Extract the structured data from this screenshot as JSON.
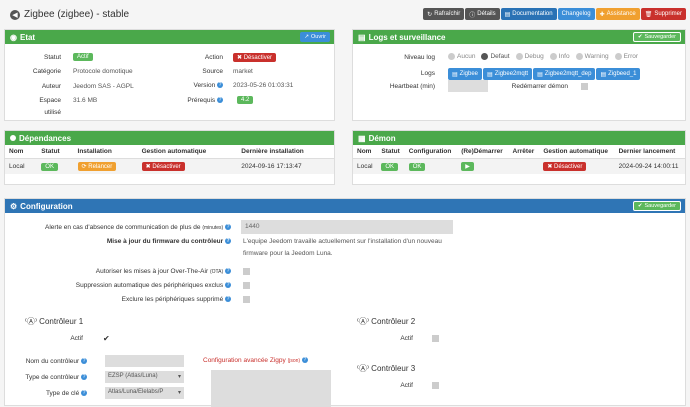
{
  "header": {
    "title": "Zigbee (zigbee) - stable",
    "buttons": {
      "refresh": "Rafraîchir",
      "details": "Détails",
      "documentation": "Documentation",
      "changelog": "Changelog",
      "assistance": "Assistance",
      "delete": "Supprimer"
    }
  },
  "etat": {
    "title": "Etat",
    "open_label": "Ouvrir",
    "statut_label": "Statut",
    "statut_value": "Actif",
    "categorie_label": "Catégorie",
    "categorie_value": "Protocole domotique",
    "auteur_label": "Auteur",
    "auteur_value": "Jeedom SAS - AGPL",
    "espace_label": "Espace",
    "espace_label2": "utilisé",
    "espace_value": "31.6 MB",
    "action_label": "Action",
    "action_value": "Désactiver",
    "source_label": "Source",
    "source_value": "market",
    "version_label": "Version",
    "version_value": "2023-05-26 01:03:31",
    "prerequis_label": "Prérequis",
    "prerequis_value": "4.2"
  },
  "logs": {
    "title": "Logs et surveillance",
    "save_label": "Sauvegarder",
    "niveau_label": "Niveau log",
    "levels": [
      "Aucun",
      "Defaut",
      "Debug",
      "Info",
      "Warning",
      "Error"
    ],
    "logs_label": "Logs",
    "log_buttons": [
      "Zigbee",
      "Zigbee2mqtt",
      "Zigbee2mqtt_dep",
      "Zigbeed_1"
    ],
    "heartbeat_label": "Heartbeat (min)",
    "restart_label": "Redémarrer démon"
  },
  "deps": {
    "title": "Dépendances",
    "headers": [
      "Nom",
      "Statut",
      "Installation",
      "Gestion automatique",
      "Dernière installation"
    ],
    "nom": "Local",
    "statut": "OK",
    "installation": "Relancer",
    "gestion": "Désactiver",
    "derniere": "2024-09-16 17:13:47"
  },
  "demon": {
    "title": "Démon",
    "headers": [
      "Nom",
      "Statut",
      "Configuration",
      "(Re)Démarrer",
      "Arrêter",
      "Gestion automatique",
      "Dernier lancement"
    ],
    "nom": "Local",
    "statut": "OK",
    "configuration": "OK",
    "gestion": "Désactiver",
    "dernier": "2024-09-24 14:00:11"
  },
  "config": {
    "title": "Configuration",
    "save_label": "Sauvegarder",
    "alerte_label": "Alerte en cas d'absence de communication de plus de",
    "alerte_unit": "(minutes)",
    "alerte_value": "1440",
    "firmware_label": "Mise à jour du firmware du contrôleur",
    "firmware_text1": "L'equipe Jeedom travaille actuellement sur l'installation d'un nouveau",
    "firmware_text2": "firmware pour la Jeedom Luna.",
    "ota_label": "Autoriser les mises à jour Over-The-Air",
    "ota_unit": "(OTA)",
    "suppr_label": "Suppression automatique des périphériques exclus",
    "exclure_label": "Exclure les périphériques supprimé",
    "ctrl1_title": "Contrôleur 1",
    "ctrl2_title": "Contrôleur 2",
    "ctrl3_title": "Contrôleur 3",
    "actif_label": "Actif",
    "nom_ctrl_label": "Nom du contrôleur",
    "type_ctrl_label": "Type de contrôleur",
    "type_ctrl_value": "EZSP (Atlas/Luna)",
    "type_cle_label": "Type de clé",
    "type_cle_value": "Atlas/Luna/Elelabs/P",
    "zigpy_label": "Configuration avancée Zigpy",
    "zigpy_unit": "(json)"
  }
}
